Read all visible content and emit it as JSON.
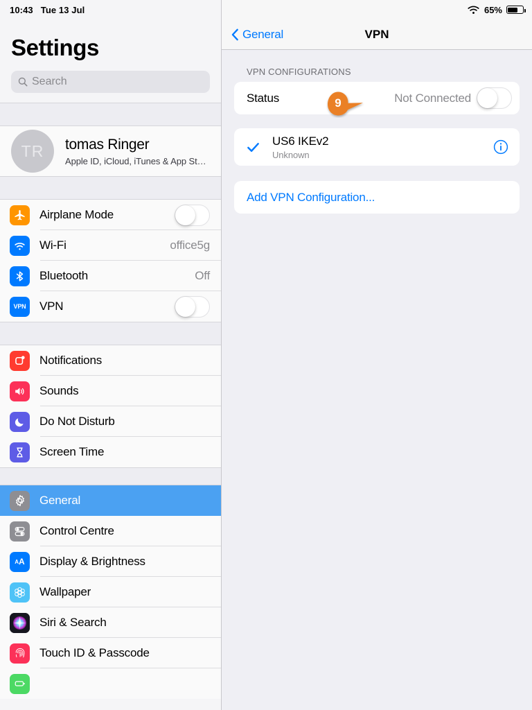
{
  "status_bar": {
    "time": "10:43",
    "date": "Tue 13 Jul",
    "battery_percent": "65%",
    "wifi_icon": "wifi-icon",
    "battery_icon": "battery-icon"
  },
  "sidebar": {
    "title": "Settings",
    "search": {
      "placeholder": "Search",
      "icon": "search-icon",
      "value": ""
    },
    "account": {
      "initials": "TR",
      "name": "tomas Ringer",
      "subtitle": "Apple ID, iCloud, iTunes & App St…"
    },
    "groups": [
      {
        "items": [
          {
            "label": "Airplane Mode",
            "icon": "airplane-icon",
            "icon_color": "#ff9500",
            "control": "toggle",
            "toggle_on": false
          },
          {
            "label": "Wi-Fi",
            "icon": "wifi-icon",
            "icon_color": "#007aff",
            "control": "value",
            "value": "office5g"
          },
          {
            "label": "Bluetooth",
            "icon": "bluetooth-icon",
            "icon_color": "#007aff",
            "control": "value",
            "value": "Off"
          },
          {
            "label": "VPN",
            "icon": "vpn-icon",
            "icon_color": "#007aff",
            "control": "toggle",
            "toggle_on": false
          }
        ]
      },
      {
        "items": [
          {
            "label": "Notifications",
            "icon": "notifications-icon",
            "icon_color": "#ff3b30",
            "control": "none"
          },
          {
            "label": "Sounds",
            "icon": "sounds-icon",
            "icon_color": "#fc3158",
            "control": "none"
          },
          {
            "label": "Do Not Disturb",
            "icon": "moon-icon",
            "icon_color": "#5e5ce6",
            "control": "none"
          },
          {
            "label": "Screen Time",
            "icon": "hourglass-icon",
            "icon_color": "#5e5ce6",
            "control": "none"
          }
        ]
      },
      {
        "items": [
          {
            "label": "General",
            "icon": "gear-icon",
            "icon_color": "#8e8e93",
            "control": "none",
            "selected": true
          },
          {
            "label": "Control Centre",
            "icon": "control-centre-icon",
            "icon_color": "#8e8e93",
            "control": "none"
          },
          {
            "label": "Display & Brightness",
            "icon": "display-brightness-icon",
            "icon_color": "#007aff",
            "control": "none"
          },
          {
            "label": "Wallpaper",
            "icon": "wallpaper-icon",
            "icon_color": "#4fc3f7",
            "control": "none"
          },
          {
            "label": "Siri & Search",
            "icon": "siri-icon",
            "icon_color": "#2a2a3c",
            "control": "none"
          },
          {
            "label": "Touch ID & Passcode",
            "icon": "touch-id-icon",
            "icon_color": "#fc3158",
            "control": "none"
          },
          {
            "label": "",
            "icon": "battery-green-icon",
            "icon_color": "#4cd964",
            "control": "none"
          }
        ]
      }
    ],
    "selected_item": "General"
  },
  "detail": {
    "back_label": "General",
    "back_icon": "chevron-left-icon",
    "title": "VPN",
    "section_header": "VPN CONFIGURATIONS",
    "status_row": {
      "label": "Status",
      "value": "Not Connected",
      "toggle_on": false
    },
    "configurations": [
      {
        "name": "US6 IKEv2",
        "subtitle": "Unknown",
        "selected": true,
        "check_icon": "checkmark-icon",
        "info_icon": "info-circle-icon"
      }
    ],
    "add_label": "Add VPN Configuration..."
  },
  "annotation": {
    "number": "9",
    "color": "#ea8025"
  }
}
